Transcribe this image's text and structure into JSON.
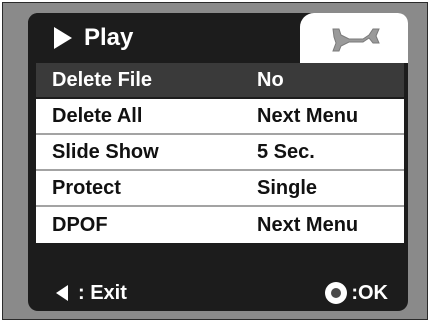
{
  "tabs": {
    "play_label": "Play",
    "play_icon": "play-triangle-icon",
    "setup_icon": "wrench-icon"
  },
  "menu": {
    "items": [
      {
        "label": "Delete File",
        "value": "No",
        "selected": true
      },
      {
        "label": "Delete All",
        "value": "Next Menu",
        "selected": false
      },
      {
        "label": "Slide Show",
        "value": "5 Sec.",
        "selected": false
      },
      {
        "label": "Protect",
        "value": "Single",
        "selected": false
      },
      {
        "label": "DPOF",
        "value": "Next Menu",
        "selected": false
      }
    ]
  },
  "footer": {
    "exit_label": ": Exit",
    "ok_label": ":OK"
  },
  "colors": {
    "screen_bg": "#1c1c1c",
    "selected_row_bg": "#3a3a3a",
    "row_bg": "#ffffff",
    "frame_bg": "#8a8a8a"
  }
}
